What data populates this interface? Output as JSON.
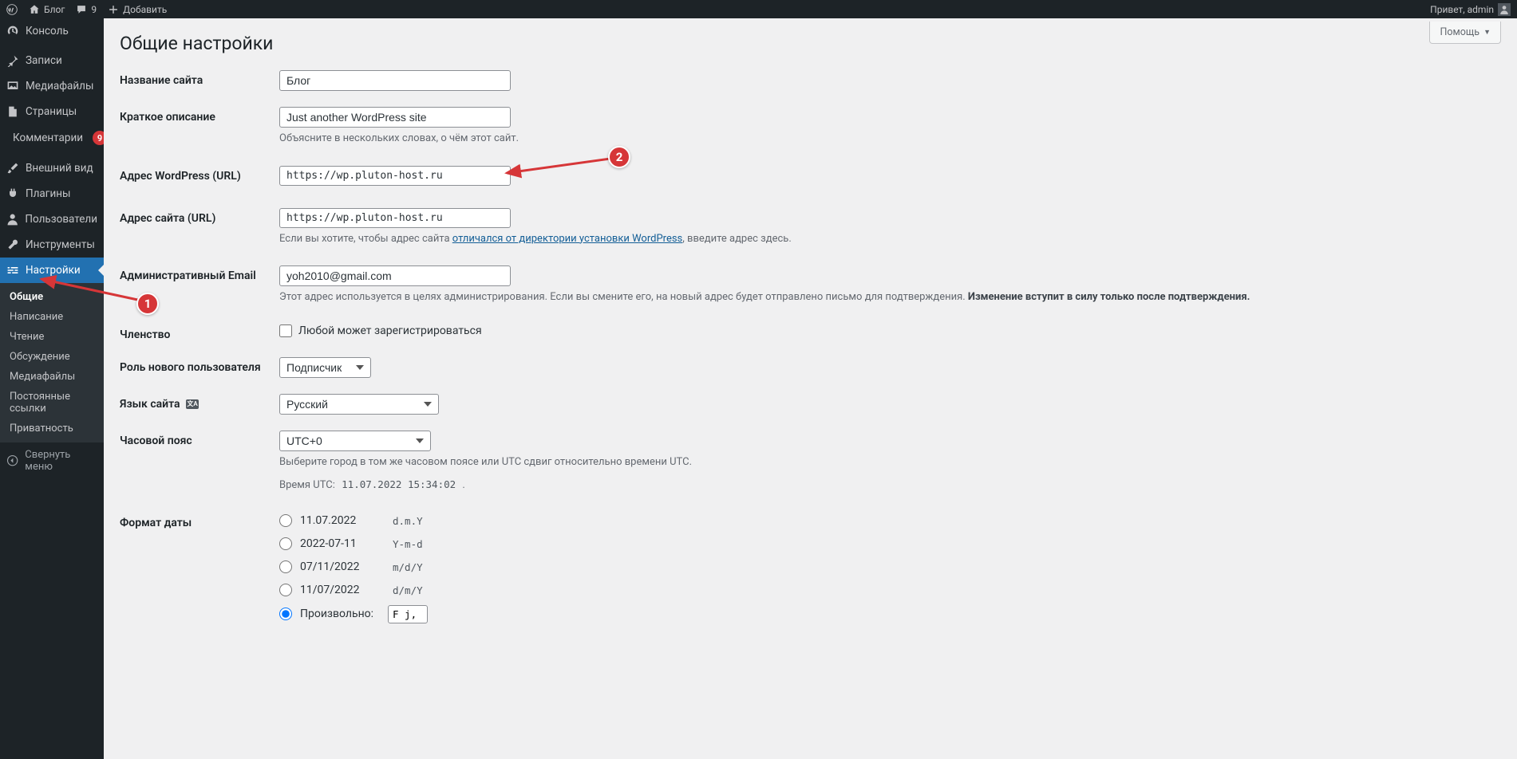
{
  "adminbar": {
    "site_name": "Блог",
    "comments_count": "9",
    "add_new": "Добавить",
    "greeting": "Привет, admin"
  },
  "menu": {
    "dashboard": "Консоль",
    "posts": "Записи",
    "media": "Медиафайлы",
    "pages": "Страницы",
    "comments": "Комментарии",
    "comments_badge": "9",
    "appearance": "Внешний вид",
    "plugins": "Плагины",
    "users": "Пользователи",
    "tools": "Инструменты",
    "settings": "Настройки",
    "collapse": "Свернуть меню",
    "sub": {
      "general": "Общие",
      "writing": "Написание",
      "reading": "Чтение",
      "discussion": "Обсуждение",
      "media": "Медиафайлы",
      "permalinks": "Постоянные ссылки",
      "privacy": "Приватность"
    }
  },
  "page": {
    "title": "Общие настройки",
    "help": "Помощь"
  },
  "form": {
    "site_title_label": "Название сайта",
    "site_title_value": "Блог",
    "tagline_label": "Краткое описание",
    "tagline_value": "Just another WordPress site",
    "tagline_desc": "Объясните в нескольких словах, о чём этот сайт.",
    "wpurl_label": "Адрес WordPress (URL)",
    "wpurl_value": "https://wp.pluton-host.ru",
    "siteurl_label": "Адрес сайта (URL)",
    "siteurl_value": "https://wp.pluton-host.ru",
    "siteurl_desc_pre": "Если вы хотите, чтобы адрес сайта ",
    "siteurl_desc_link": "отличался от директории установки WordPress",
    "siteurl_desc_post": ", введите адрес здесь.",
    "email_label": "Административный Email",
    "email_value": "yoh2010@gmail.com",
    "email_desc_plain": "Этот адрес используется в целях администрирования. Если вы смените его, на новый адрес будет отправлено письмо для подтверждения. ",
    "email_desc_strong": "Изменение вступит в силу только после подтверждения.",
    "membership_label": "Членство",
    "membership_check": "Любой может зарегистрироваться",
    "role_label": "Роль нового пользователя",
    "role_value": "Подписчик",
    "lang_label": "Язык сайта",
    "lang_value": "Русский",
    "tz_label": "Часовой пояс",
    "tz_value": "UTC+0",
    "tz_desc": "Выберите город в том же часовом поясе или UTC сдвиг относительно времени UTC.",
    "tz_utc_label": "Время UTC:",
    "tz_utc_value": "11.07.2022 15:34:02",
    "date_label": "Формат даты",
    "date_options": [
      {
        "example": "11.07.2022",
        "fmt": "d.m.Y",
        "checked": false
      },
      {
        "example": "2022-07-11",
        "fmt": "Y-m-d",
        "checked": false
      },
      {
        "example": "07/11/2022",
        "fmt": "m/d/Y",
        "checked": false
      },
      {
        "example": "11/07/2022",
        "fmt": "d/m/Y",
        "checked": false
      }
    ],
    "date_custom_label": "Произвольно:",
    "date_custom_value": "F j, Y"
  },
  "annotations": {
    "n1": "1",
    "n2": "2"
  }
}
